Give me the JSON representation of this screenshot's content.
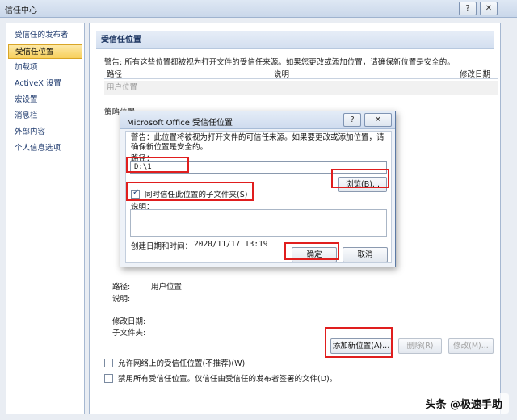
{
  "window": {
    "title": "信任中心",
    "help_label": "?",
    "close_label": "✕"
  },
  "sidebar": {
    "items": [
      {
        "label": "受信任的发布者"
      },
      {
        "label": "受信任位置"
      },
      {
        "label": "加载项"
      },
      {
        "label": "ActiveX 设置"
      },
      {
        "label": "宏设置"
      },
      {
        "label": "消息栏"
      },
      {
        "label": "外部内容"
      },
      {
        "label": "个人信息选项"
      }
    ],
    "active_index": 1
  },
  "main": {
    "section_title": "受信任位置",
    "warning": "警告: 所有这些位置都被视为打开文件的受信任来源。如果您更改或添加位置，请确保新位置是安全的。",
    "columns": {
      "path": "路径",
      "description": "说明",
      "modified": "修改日期"
    },
    "user_locations_label": "用户位置",
    "policy_locations_label": "策略位置",
    "details": {
      "path_label": "路径:",
      "path_value": "用户位置",
      "description_label": "说明:",
      "modified_label": "修改日期:",
      "subfolders_label": "子文件夹:"
    },
    "buttons": {
      "add": "添加新位置(A)...",
      "remove": "删除(R)",
      "modify": "修改(M)..."
    },
    "options": {
      "allow_network": "允许网络上的受信任位置(不推荐)(W)",
      "disable_all": "禁用所有受信任位置。仅信任由受信任的发布者签署的文件(D)。"
    }
  },
  "dialog": {
    "title": "Microsoft Office 受信任位置",
    "help_label": "?",
    "close_label": "✕",
    "warning": "警告：此位置将被视为打开文件的可信任来源。如果要更改或添加位置，请确保新位置是安全的。",
    "path_label": "路径：",
    "path_value": "D:\\1",
    "browse_label": "浏览(B)...",
    "subfolders_label": "同时信任此位置的子文件夹(S)",
    "subfolders_checked": true,
    "description_label": "说明：",
    "created_label": "创建日期和时间：",
    "created_value": "2020/11/17  13:19",
    "ok_label": "确定",
    "cancel_label": "取消"
  },
  "watermark": "头条 @极速手助",
  "colors": {
    "highlight_box": "#e01e1e",
    "active_nav": "#f7cf5b",
    "header_bg": "#d3dff0"
  }
}
